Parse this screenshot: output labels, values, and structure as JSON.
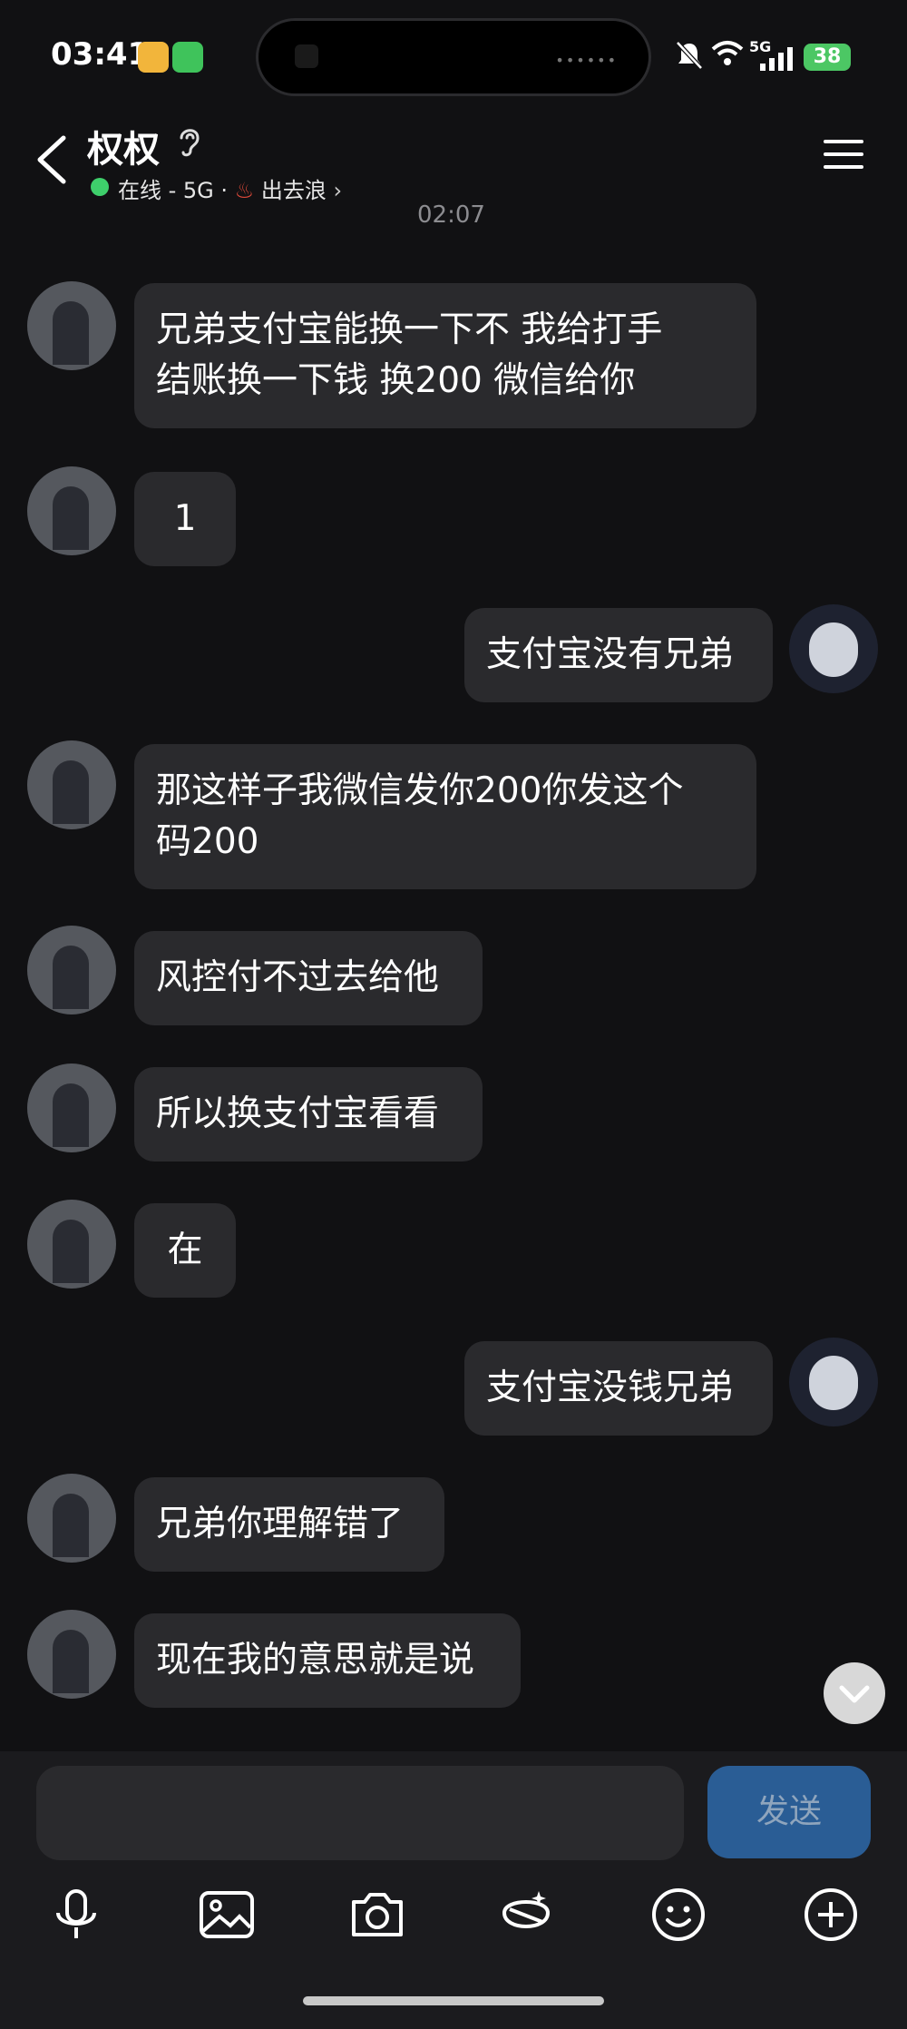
{
  "status": {
    "time": "03:41",
    "signal_label": "5G",
    "battery": "38"
  },
  "header": {
    "title": "权权",
    "online_text": "在线 - 5G · ",
    "activity_text": "出去浪"
  },
  "timestamp": "02:07",
  "messages": [
    {
      "side": "left",
      "text": "兄弟支付宝能换一下不 我给打手\n结账换一下钱 换200 微信给你"
    },
    {
      "side": "left",
      "text": "1"
    },
    {
      "side": "right",
      "text": "支付宝没有兄弟"
    },
    {
      "side": "left",
      "text": "那这样子我微信发你200你发这个\n码200"
    },
    {
      "side": "left",
      "text": "风控付不过去给他"
    },
    {
      "side": "left",
      "text": "所以换支付宝看看"
    },
    {
      "side": "left",
      "text": "在"
    },
    {
      "side": "right",
      "text": "支付宝没钱兄弟"
    },
    {
      "side": "left",
      "text": "兄弟你理解错了"
    },
    {
      "side": "left",
      "text": "现在我的意思就是说"
    }
  ],
  "composer": {
    "placeholder": "",
    "send_label": "发送"
  },
  "toolbar": {
    "icons": [
      "microphone-icon",
      "image-icon",
      "camera-icon",
      "red-envelope-icon",
      "emoji-icon",
      "plus-icon"
    ]
  }
}
